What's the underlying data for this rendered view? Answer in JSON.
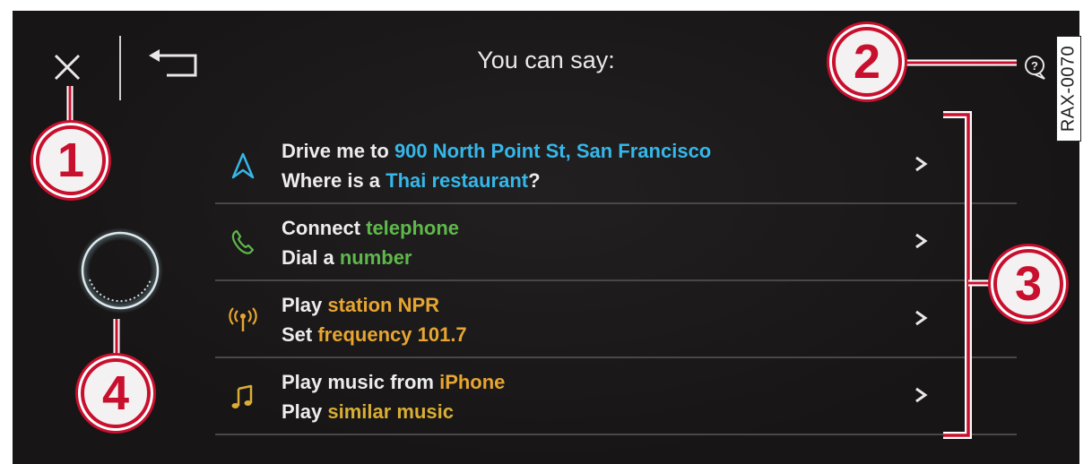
{
  "header": {
    "title": "You can say:"
  },
  "icons": {
    "close": "close-icon",
    "back": "back-arrow-icon",
    "help": "help-speech-bubble-icon",
    "mic": "voice-activity-ring-icon",
    "chevron": "chevron-right-icon"
  },
  "colors": {
    "background": "#171515",
    "text": "#ededed",
    "navigation": "#35b7ea",
    "phone": "#5fb84c",
    "radio": "#e7a531",
    "media": "#d9ae35",
    "callout": "#c8102e"
  },
  "suggestions": [
    {
      "category_icon": "navigation-arrow-icon",
      "line1_prefix": "Drive me to ",
      "line1_highlight": "900 North Point St, San Francisco",
      "line2_prefix": "Where is a ",
      "line2_highlight": "Thai restaurant",
      "line2_suffix": "?",
      "chevron": ">"
    },
    {
      "category_icon": "telephone-icon",
      "line1_prefix": "Connect ",
      "line1_highlight": "telephone",
      "line2_prefix": "Dial a ",
      "line2_highlight": "number",
      "line2_suffix": "",
      "chevron": ">"
    },
    {
      "category_icon": "radio-antenna-icon",
      "line1_prefix": "Play ",
      "line1_highlight": "station NPR",
      "line2_prefix": "Set ",
      "line2_highlight": "frequency 101.7",
      "line2_suffix": "",
      "chevron": ">"
    },
    {
      "category_icon": "music-note-icon",
      "line1_prefix": "Play music from ",
      "line1_highlight": "iPhone",
      "line2_prefix": "Play ",
      "line2_highlight": "similar music",
      "line2_suffix": "",
      "chevron": ">"
    }
  ],
  "callouts": [
    "1",
    "2",
    "3",
    "4"
  ],
  "reference_code": "RAX-0070"
}
